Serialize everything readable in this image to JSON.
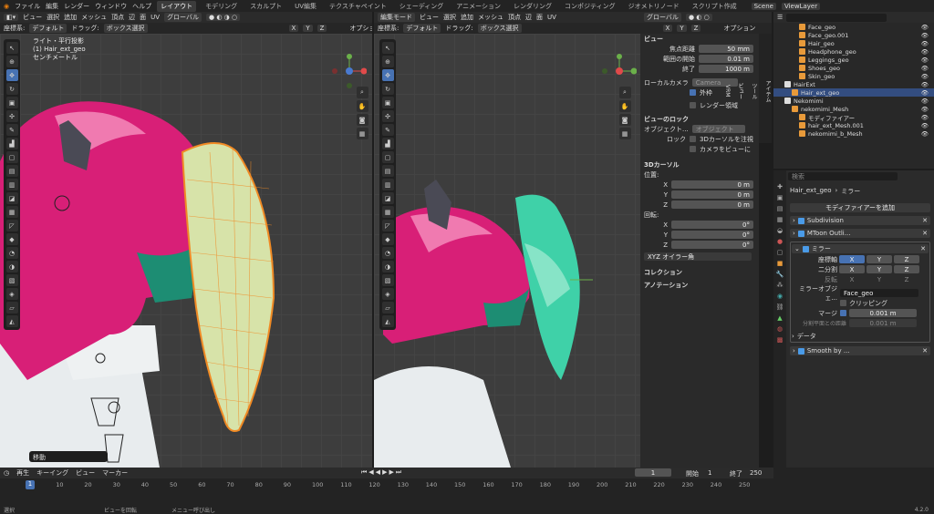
{
  "topbar": {
    "menus": [
      "ファイル",
      "編集",
      "レンダー",
      "ウィンドウ",
      "ヘルプ"
    ],
    "tabs": [
      "レイアウト",
      "モデリング",
      "スカルプト",
      "UV編集",
      "テクスチャペイント",
      "シェーディング",
      "アニメーション",
      "レンダリング",
      "コンポジティング",
      "ジオメトリノード",
      "スクリプト作成"
    ],
    "scene": "Scene",
    "viewlayer": "ViewLayer"
  },
  "left_view": {
    "menus": [
      "ビュー",
      "選択",
      "追加",
      "メッシュ",
      "頂点",
      "辺",
      "面",
      "UV"
    ],
    "orientation": "グローバル",
    "coord_label": "座標系:",
    "coord_value": "デフォルト",
    "drag": "ドラッグ:",
    "select_mode": "ボックス選択",
    "axes": [
      "X",
      "Y",
      "Z"
    ],
    "options": "オプション",
    "info": [
      "ライト・平行投影",
      "(1) Hair_ext_geo",
      "センチメートル"
    ],
    "last_op": "移動"
  },
  "right_view": {
    "mode": "編集モード",
    "menus": [
      "ビュー",
      "選択",
      "追加",
      "メッシュ",
      "頂点",
      "辺",
      "面",
      "UV"
    ],
    "orientation": "グローバル",
    "coord_label": "座標系:",
    "coord_value": "デフォルト",
    "drag": "ドラッグ:",
    "select_mode": "ボックス選択",
    "axes": [
      "X",
      "Y",
      "Z"
    ],
    "options": "オプション"
  },
  "n_panel": {
    "view_title": "ビュー",
    "focal_label": "焦点距離",
    "focal": "50 mm",
    "clip_start_label": "範囲の開始",
    "clip_start": "0.01 m",
    "clip_end_label": "終了",
    "clip_end": "1000 m",
    "local_cam_label": "ローカルカメラ",
    "camera": "Camera",
    "outside": "外枠",
    "render_region": "レンダー領域",
    "lock_title": "ビューのロック",
    "lock_object_label": "オブジェクト...",
    "lock_object": "オブジェクト",
    "lock_label": "ロック",
    "lock_cursor": "3Dカーソルを注視",
    "cam_to_view": "カメラをビューに",
    "cursor_title": "3Dカーソル",
    "location": "位置:",
    "loc": [
      {
        "axis": "X",
        "value": "0 m"
      },
      {
        "axis": "Y",
        "value": "0 m"
      },
      {
        "axis": "Z",
        "value": "0 m"
      }
    ],
    "rotation": "回転:",
    "rot": [
      {
        "axis": "X",
        "value": "0°"
      },
      {
        "axis": "Y",
        "value": "0°"
      },
      {
        "axis": "Z",
        "value": "0°"
      }
    ],
    "rot_mode": "XYZ オイラー角",
    "collection": "コレクション",
    "annotation": "アノテーション",
    "tabs": [
      "アイテム",
      "ツール",
      "ビュー",
      "VRM"
    ]
  },
  "outliner": {
    "search_placeholder": "",
    "rows": [
      {
        "label": "Face_geo",
        "indent": 3,
        "selected": false
      },
      {
        "label": "Face_geo.001",
        "indent": 3,
        "selected": false
      },
      {
        "label": "Hair_geo",
        "indent": 3,
        "selected": false
      },
      {
        "label": "Headphone_geo",
        "indent": 3,
        "selected": false
      },
      {
        "label": "Leggings_geo",
        "indent": 3,
        "selected": false
      },
      {
        "label": "Shoes_geo",
        "indent": 3,
        "selected": false
      },
      {
        "label": "Skin_geo",
        "indent": 3,
        "selected": false
      },
      {
        "label": "HairExt",
        "indent": 1,
        "selected": false
      },
      {
        "label": "Hair_ext_geo",
        "indent": 2,
        "selected": true
      },
      {
        "label": "Nekomimi",
        "indent": 1,
        "selected": false
      },
      {
        "label": "nekomimi_Mesh",
        "indent": 2,
        "selected": false
      },
      {
        "label": "モディファイアー",
        "indent": 3,
        "selected": false
      },
      {
        "label": "hair_ext_Mesh.001",
        "indent": 3,
        "selected": false
      },
      {
        "label": "nekomimi_b_Mesh",
        "indent": 3,
        "selected": false
      }
    ]
  },
  "properties": {
    "search_placeholder": "検索",
    "breadcrumb_obj": "Hair_ext_geo",
    "breadcrumb_mod": "ミラー",
    "add_modifier": "モディファイアーを追加",
    "modifiers": [
      "Subdivision",
      "MToon Outli...",
      "ミラー"
    ],
    "axis_label": "座標軸",
    "bisect_label": "二分割",
    "flip_label": "反転",
    "axes": [
      "X",
      "Y",
      "Z"
    ],
    "mirror_obj_label": "ミラーオブジェ...",
    "mirror_obj": "Face_geo",
    "clipping": "クリッピング",
    "merge_label": "マージ",
    "merge": "0.001 m",
    "bisect_dist_label": "分割平面との距離",
    "bisect_dist": "0.001 m",
    "data": "データ",
    "smooth": "Smooth by ..."
  },
  "timeline": {
    "menus": [
      "再生",
      "キーイング",
      "ビュー",
      "マーカー"
    ],
    "current": "1",
    "start_label": "開始",
    "start": "1",
    "end_label": "終了",
    "end": "250",
    "ticks": [
      "0",
      "10",
      "20",
      "30",
      "40",
      "50",
      "60",
      "70",
      "80",
      "90",
      "100",
      "110",
      "120",
      "130",
      "140",
      "150",
      "160",
      "170",
      "180",
      "190",
      "200",
      "210",
      "220",
      "230",
      "240",
      "250"
    ],
    "current_marker": "1"
  },
  "statusbar": {
    "select": "選択",
    "rotate": "ビューを回転",
    "menu": "メニュー呼び出し",
    "version": "4.2.0"
  },
  "colors": {
    "accent": "#4772b3",
    "hair_pink": "#e0287a",
    "hair_teal": "#3fd1a8",
    "selection_orange": "#f08a24"
  }
}
